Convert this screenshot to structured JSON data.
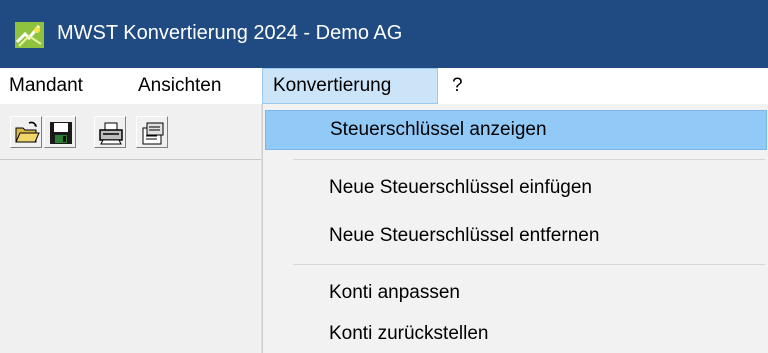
{
  "window": {
    "title": "MWST Konvertierung 2024 - Demo AG",
    "icon": "app-logo-icon"
  },
  "menubar": {
    "items": [
      {
        "label": "Mandant"
      },
      {
        "label": "Ansichten"
      },
      {
        "label": "Konvertierung",
        "active": true
      },
      {
        "label": "?"
      }
    ]
  },
  "toolbar": {
    "buttons": [
      {
        "icon": "open-folder-icon"
      },
      {
        "icon": "save-disk-icon"
      },
      {
        "icon": "printer-icon"
      },
      {
        "icon": "properties-icon"
      }
    ]
  },
  "dropdown": {
    "items": [
      {
        "label": "Steuerschlüssel anzeigen",
        "highlighted": true
      },
      {
        "label": "Neue Steuerschlüssel einfügen"
      },
      {
        "label": "Neue Steuerschlüssel entfernen"
      },
      {
        "label": "Konti anpassen"
      },
      {
        "label": "Konti zurückstellen"
      }
    ]
  },
  "colors": {
    "titlebar": "#1f4a82",
    "highlight": "#91c9f7",
    "menu_active": "#cce4f7"
  }
}
